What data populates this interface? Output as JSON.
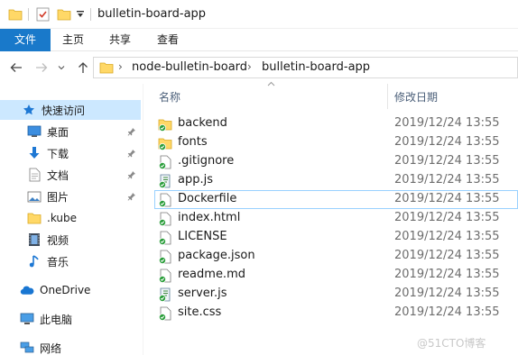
{
  "window": {
    "title": "bulletin-board-app"
  },
  "ribbon": {
    "tabs": [
      {
        "label": "文件"
      },
      {
        "label": "主页"
      },
      {
        "label": "共享"
      },
      {
        "label": "查看"
      }
    ]
  },
  "address": {
    "crumbs": [
      "node-bulletin-board",
      "bulletin-board-app"
    ],
    "separator": "›"
  },
  "sidebar": {
    "items": [
      {
        "label": "快速访问",
        "icon": "star-icon",
        "selected": true
      },
      {
        "label": "桌面",
        "icon": "desktop-icon",
        "pinned": true
      },
      {
        "label": "下载",
        "icon": "download-icon",
        "pinned": true
      },
      {
        "label": "文档",
        "icon": "document-icon",
        "pinned": true
      },
      {
        "label": "图片",
        "icon": "pictures-icon",
        "pinned": true
      },
      {
        "label": ".kube",
        "icon": "folder-icon"
      },
      {
        "label": "视频",
        "icon": "video-icon"
      },
      {
        "label": "音乐",
        "icon": "music-icon"
      },
      {
        "label": "OneDrive",
        "icon": "cloud-icon"
      },
      {
        "label": "此电脑",
        "icon": "computer-icon"
      },
      {
        "label": "网络",
        "icon": "network-icon"
      }
    ]
  },
  "filelist": {
    "columns": {
      "name": "名称",
      "modified": "修改日期"
    },
    "rows": [
      {
        "name": "backend",
        "date": "2019/12/24 13:55",
        "kind": "folder"
      },
      {
        "name": "fonts",
        "date": "2019/12/24 13:55",
        "kind": "folder"
      },
      {
        "name": ".gitignore",
        "date": "2019/12/24 13:55",
        "kind": "file"
      },
      {
        "name": "app.js",
        "date": "2019/12/24 13:55",
        "kind": "script"
      },
      {
        "name": "Dockerfile",
        "date": "2019/12/24 13:55",
        "kind": "file",
        "focused": true
      },
      {
        "name": "index.html",
        "date": "2019/12/24 13:55",
        "kind": "file"
      },
      {
        "name": "LICENSE",
        "date": "2019/12/24 13:55",
        "kind": "file"
      },
      {
        "name": "package.json",
        "date": "2019/12/24 13:55",
        "kind": "file"
      },
      {
        "name": "readme.md",
        "date": "2019/12/24 13:55",
        "kind": "file"
      },
      {
        "name": "server.js",
        "date": "2019/12/24 13:55",
        "kind": "script"
      },
      {
        "name": "site.css",
        "date": "2019/12/24 13:55",
        "kind": "file"
      }
    ]
  },
  "watermark": "@51CTO博客",
  "colors": {
    "accent": "#1979ca",
    "selection": "#cce8ff",
    "folder": "#ffd867",
    "sync_ok": "#2a9d3a"
  }
}
